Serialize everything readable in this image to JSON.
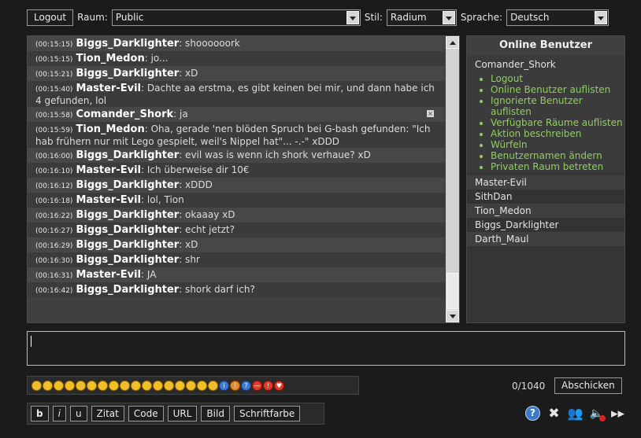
{
  "top": {
    "logout_label": "Logout",
    "room_label": "Raum:",
    "room_value": "Public",
    "style_label": "Stil:",
    "style_value": "Radium",
    "language_label": "Sprache:",
    "language_value": "Deutsch"
  },
  "messages": [
    {
      "time": "(00:15:15)",
      "user": "Biggs_Darklighter",
      "text": ": shoooooork"
    },
    {
      "time": "(00:15:15)",
      "user": "Tion_Medon",
      "text": ": jo..."
    },
    {
      "time": "(00:15:21)",
      "user": "Biggs_Darklighter",
      "text": ": xD"
    },
    {
      "time": "(00:15:40)",
      "user": "Master-Evil",
      "text": ": Dachte aa erstma, es gibt keinen bei mir, und dann habe ich 4 gefunden, lol"
    },
    {
      "time": "(00:15:58)",
      "user": "Comander_Shork",
      "text": ": ja"
    },
    {
      "time": "(00:15:59)",
      "user": "Tion_Medon",
      "text": ": Oha, gerade 'nen blöden Spruch bei G-bash gefunden: \"Ich hab frühern nur mit Lego gespielt, weil's Nippel hat\"... -.-\" xDDD"
    },
    {
      "time": "(00:16:00)",
      "user": "Biggs_Darklighter",
      "text": ": evil was is wenn ich shork verhaue? xD"
    },
    {
      "time": "(00:16:10)",
      "user": "Master-Evil",
      "text": ": Ich überweise dir 10€"
    },
    {
      "time": "(00:16:12)",
      "user": "Biggs_Darklighter",
      "text": ": xDDD"
    },
    {
      "time": "(00:16:18)",
      "user": "Master-Evil",
      "text": ": lol, Tion"
    },
    {
      "time": "(00:16:22)",
      "user": "Biggs_Darklighter",
      "text": ": okaaay xD"
    },
    {
      "time": "(00:16:27)",
      "user": "Biggs_Darklighter",
      "text": ": echt jetzt?"
    },
    {
      "time": "(00:16:29)",
      "user": "Biggs_Darklighter",
      "text": ": xD"
    },
    {
      "time": "(00:16:30)",
      "user": "Biggs_Darklighter",
      "text": ": shr"
    },
    {
      "time": "(00:16:31)",
      "user": "Master-Evil",
      "text": ": JA"
    },
    {
      "time": "(00:16:42)",
      "user": "Biggs_Darklighter",
      "text": ": shork darf ich?"
    }
  ],
  "online": {
    "title": "Online Benutzer",
    "self": "Comander_Shork",
    "menu": [
      "Logout",
      "Online Benutzer auflisten",
      "Ignorierte Benutzer auflisten",
      "Verfügbare Räume auflisten",
      "Aktion beschreiben",
      "Würfeln",
      "Benutzernamen ändern",
      "Privaten Raum betreten"
    ],
    "users": [
      "Master-Evil",
      "SithDan",
      "Tion_Medon",
      "Biggs_Darklighter",
      "Darth_Maul"
    ]
  },
  "input": {
    "char_count": "0/1040",
    "send_label": "Abschicken"
  },
  "format": {
    "bold": "b",
    "italic": "i",
    "underline": "u",
    "quote": "Zitat",
    "code": "Code",
    "url": "URL",
    "image": "Bild",
    "font_color": "Schriftfarbe"
  },
  "emoticons": [
    "smile",
    "sad",
    "wink",
    "tongue",
    "grin",
    "neutral",
    "surprised",
    "blush",
    "cool",
    "confused",
    "sunglasses",
    "laugh",
    "cry",
    "shocked",
    "happy",
    "devil",
    "alien",
    "idea",
    "exclamation",
    "question",
    "stop",
    "warning",
    "heart"
  ],
  "tools": [
    "help-icon",
    "settings-icon",
    "online-users-icon",
    "sound-off-icon",
    "expand-icon"
  ]
}
